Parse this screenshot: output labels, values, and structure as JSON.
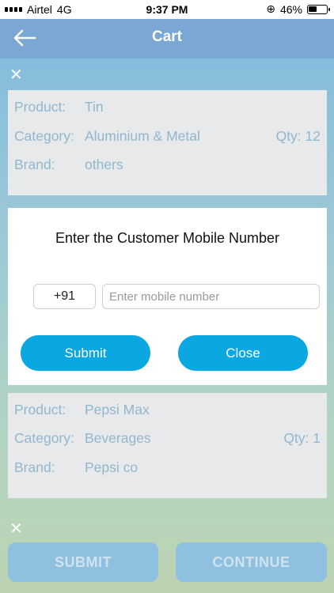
{
  "status_bar": {
    "carrier": "Airtel",
    "network": "4G",
    "time": "9:37 PM",
    "battery_percent": "46%",
    "battery_level": 0.46
  },
  "app_bar": {
    "title": "Cart",
    "back_icon": "arrow-left-icon"
  },
  "cart": {
    "items": [
      {
        "product_label": "Product:",
        "product": "Tin",
        "category_label": "Category:",
        "category": "Aluminium & Metal",
        "qty": "Qty: 12",
        "brand_label": "Brand:",
        "brand": "others"
      },
      {
        "product_label": "Product:",
        "product": "Pepsi  Max",
        "category_label": "Category:",
        "category": "Beverages",
        "qty": "Qty: 1",
        "brand_label": "Brand:",
        "brand": "Pepsi co"
      }
    ],
    "remove_icon": "close-icon",
    "buttons": {
      "submit": "SUBMIT",
      "continue": "CONTINUE"
    }
  },
  "modal": {
    "title": "Enter the Customer Mobile Number",
    "country_code": "+91",
    "mobile_placeholder": "Enter mobile number",
    "mobile_value": "",
    "submit_label": "Submit",
    "close_label": "Close"
  },
  "colors": {
    "accent": "#0aa7e0",
    "app_bar": "#7aa7d4",
    "card_text": "#91b7cf"
  }
}
